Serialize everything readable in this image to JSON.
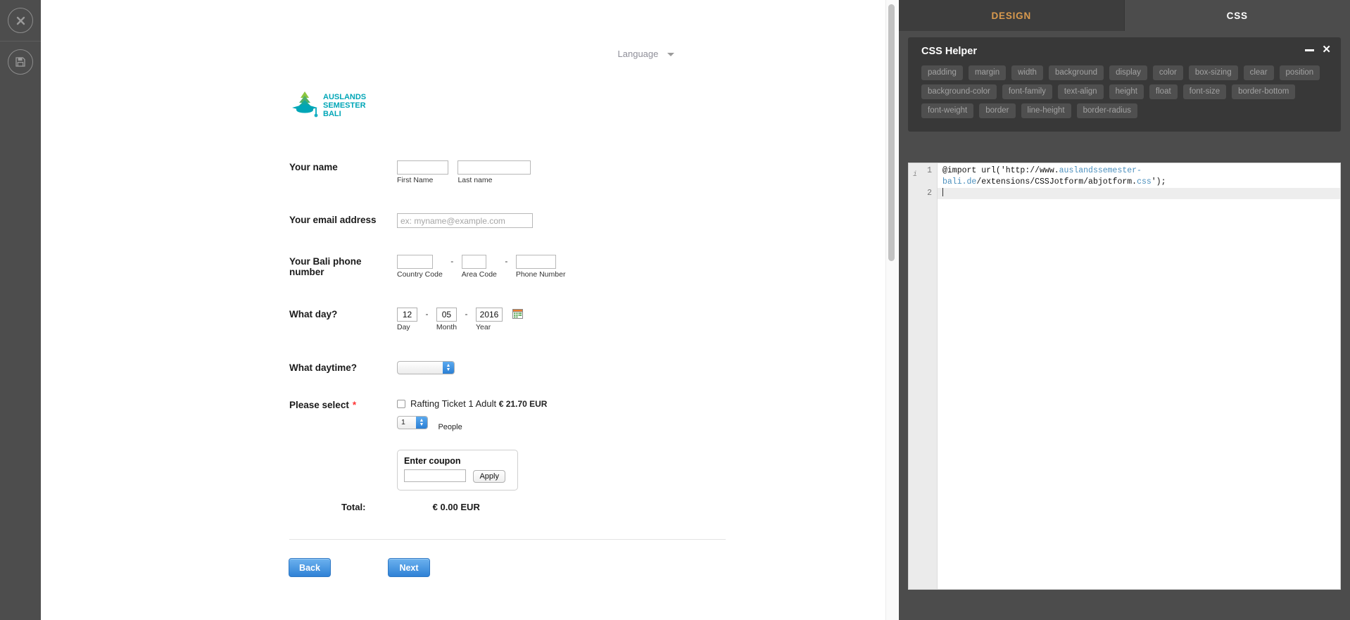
{
  "rail": {
    "items": [
      {
        "name": "close-icon",
        "label": "Close"
      },
      {
        "name": "save-icon",
        "label": "Save"
      }
    ]
  },
  "form": {
    "language_label": "Language",
    "logo_lines": [
      "AUSLANDS",
      "SEMESTER",
      "BALI"
    ],
    "fields": [
      {
        "label": "Your name",
        "required": false,
        "sub_first": "First Name",
        "sub_last": "Last name",
        "value_first": "",
        "value_last": ""
      },
      {
        "label": "Your email address",
        "required": false,
        "placeholder": "ex: myname@example.com",
        "value": ""
      },
      {
        "label": "Your Bali phone number",
        "required": false,
        "sub_country": "Country Code",
        "sub_area": "Area Code",
        "sub_phone": "Phone Number",
        "separator": "-",
        "value_country": "",
        "value_area": "",
        "value_phone": ""
      },
      {
        "label": "What day?",
        "required": false,
        "day": "12",
        "month": "05",
        "year": "2016",
        "sub_day": "Day",
        "sub_month": "Month",
        "sub_year": "Year",
        "separator": "-",
        "calendar_icon": "calendar-icon"
      },
      {
        "label": "What daytime?",
        "required": false,
        "selected": ""
      },
      {
        "label": "Please select",
        "required": true,
        "required_mark": "*",
        "product_name": "Rafting Ticket 1 Adult",
        "product_price": "€ 21.70 EUR",
        "quantity": "1",
        "quantity_label": "People",
        "coupon_title": "Enter coupon",
        "coupon_value": "",
        "coupon_button": "Apply"
      }
    ],
    "total_label": "Total:",
    "total_value": "€ 0.00 EUR",
    "back_button": "Back",
    "next_button": "Next"
  },
  "panel": {
    "tabs": [
      {
        "label": "DESIGN",
        "active": true
      },
      {
        "label": "CSS",
        "active": false
      }
    ],
    "helper": {
      "title": "CSS Helper",
      "minimize_icon": "minimize-icon",
      "close_icon": "close-icon",
      "tags": [
        "padding",
        "margin",
        "width",
        "background",
        "display",
        "color",
        "box-sizing",
        "clear",
        "position",
        "background-color",
        "font-family",
        "text-align",
        "height",
        "float",
        "font-size",
        "border-bottom",
        "font-weight",
        "border",
        "line-height",
        "border-radius"
      ]
    },
    "editor": {
      "line_numbers": [
        "1",
        "2"
      ],
      "info_glyph": "i",
      "code_segment_1": "@import url('http://www.",
      "code_segment_2": "auslandssemester-bali.de",
      "code_segment_3": "/extensions/CSSJotform",
      "code_segment_4": "/abjotform.",
      "code_segment_5": "css",
      "code_segment_6": "');"
    }
  },
  "colors": {
    "rail_bg": "#4d4d4d",
    "panel_bg": "#4c4c4c",
    "tab_active_bg": "#3d3d3d",
    "tab_active_text": "#d99a4e",
    "helper_bg": "#383838",
    "tag_bg": "#4f4f4f",
    "tag_text": "#a2a2a2",
    "button_blue": "#2f81d6",
    "logo_teal": "#00a6b7",
    "logo_green": "#5ec15a",
    "required_red": "#ff3333",
    "code_link": "#4a8fbd"
  }
}
